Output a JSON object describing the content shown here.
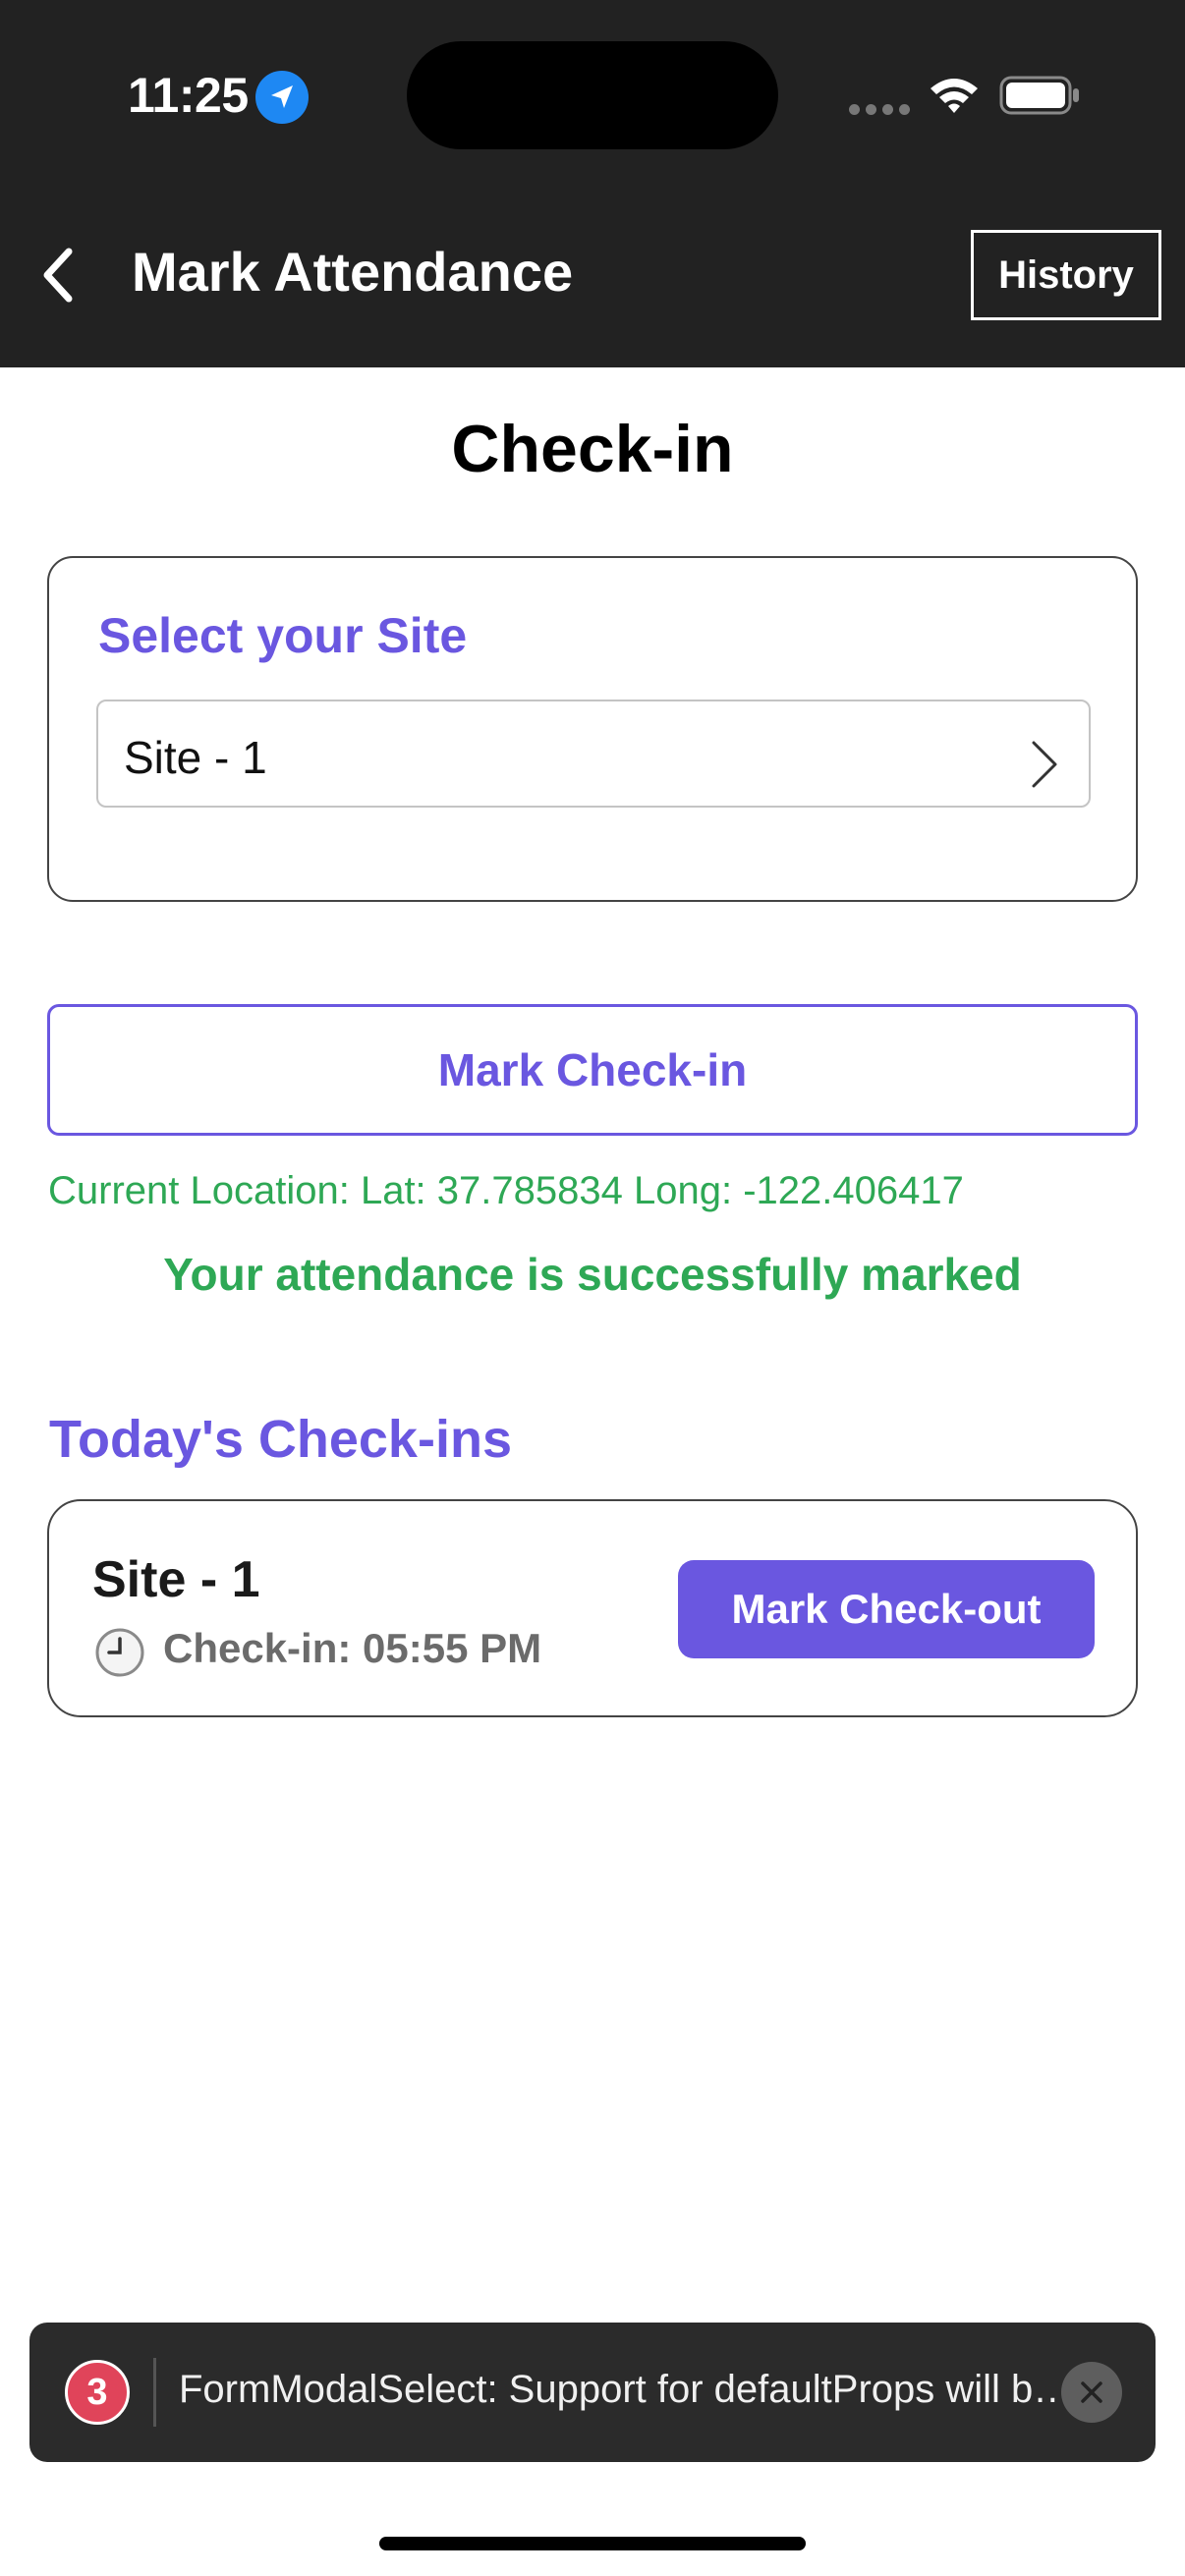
{
  "status_bar": {
    "time": "11:25",
    "icons": [
      "location-arrow-icon",
      "cellular-signal-icon",
      "wifi-icon",
      "battery-icon"
    ]
  },
  "nav": {
    "back_icon": "chevron-left-icon",
    "title": "Mark Attendance",
    "history_label": "History"
  },
  "page": {
    "title": "Check-in"
  },
  "site_selector": {
    "label": "Select your Site",
    "selected_value": "Site - 1",
    "icon": "chevron-right-icon"
  },
  "actions": {
    "mark_checkin_label": "Mark Check-in"
  },
  "location": {
    "text": "Current Location: Lat: 37.785834 Long: -122.406417"
  },
  "status_message": "Your attendance is successfully marked",
  "todays_checkins": {
    "title": "Today's Check-ins",
    "items": [
      {
        "site": "Site - 1",
        "checkin_text": "Check-in: 05:55 PM",
        "checkout_label": "Mark Check-out"
      }
    ]
  },
  "toast": {
    "count": "3",
    "message": "FormModalSelect: Support for defaultProps will be removed from function components in a future major release.",
    "close_icon": "close-icon"
  },
  "colors": {
    "header_bg": "#222222",
    "accent": "#6a57e0",
    "success": "#2ea855",
    "toast_bg": "#2b2b2b",
    "toast_badge": "#e0445a"
  }
}
